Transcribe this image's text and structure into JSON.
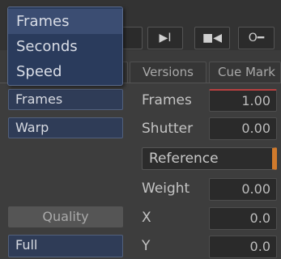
{
  "dropdown_menu": {
    "items": [
      "Frames",
      "Seconds",
      "Speed"
    ],
    "highlighted_index": 0
  },
  "toolbar": {
    "buttons": [
      {
        "icon": "step-forward-icon",
        "glyph": "▶I"
      },
      {
        "icon": "step-back-icon",
        "glyph": "■◀"
      },
      {
        "icon": "key-icon",
        "glyph": "O━"
      }
    ]
  },
  "tabs": [
    "Versions",
    "Cue Mark"
  ],
  "left_panel": {
    "mode_select": "Frames",
    "method_select": "Warp",
    "quality_label": "Quality",
    "quality_select": "Full"
  },
  "params": {
    "frames_label": "Frames",
    "frames_value": "1.00",
    "shutter_label": "Shutter",
    "shutter_value": "0.00",
    "reference_label": "Reference",
    "weight_label": "Weight",
    "weight_value": "0.00",
    "x_label": "X",
    "x_value": "0.0",
    "y_label": "Y",
    "y_value": "0.0"
  },
  "colors": {
    "menu_bg": "#2a3b5c",
    "accent_orange": "#d07a2c",
    "accent_red": "#b84040"
  }
}
